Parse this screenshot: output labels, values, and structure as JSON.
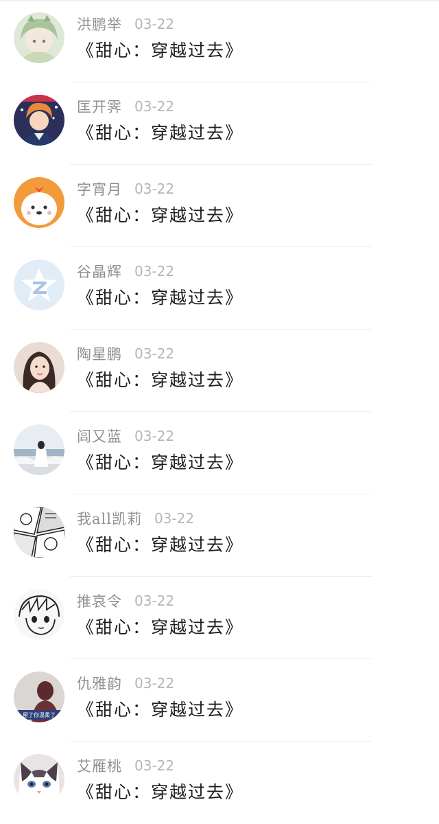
{
  "comments": [
    {
      "name": "洪鹏举",
      "date": "03-22",
      "title": "《甜心：穿越过去》",
      "avatar": "avatar-anime-green-hair-icon"
    },
    {
      "name": "匡开霁",
      "date": "03-22",
      "title": "《甜心：穿越过去》",
      "avatar": "avatar-anime-boy-flag-icon"
    },
    {
      "name": "字宵月",
      "date": "03-22",
      "title": "《甜心：穿越过去》",
      "avatar": "avatar-cartoon-dog-icon"
    },
    {
      "name": "谷晶辉",
      "date": "03-22",
      "title": "《甜心：穿越过去》",
      "avatar": "avatar-qzone-star-icon"
    },
    {
      "name": "陶星鹏",
      "date": "03-22",
      "title": "《甜心：穿越过去》",
      "avatar": "avatar-girl-photo-icon"
    },
    {
      "name": "闾又蓝",
      "date": "03-22",
      "title": "《甜心：穿越过去》",
      "avatar": "avatar-seaside-girl-icon"
    },
    {
      "name": "我all凯莉",
      "date": "03-22",
      "title": "《甜心：穿越过去》",
      "avatar": "avatar-manga-panel-icon"
    },
    {
      "name": "推哀令",
      "date": "03-22",
      "title": "《甜心：穿越过去》",
      "avatar": "avatar-manga-sketch-icon"
    },
    {
      "name": "仇雅韵",
      "date": "03-22",
      "title": "《甜心：穿越过去》",
      "avatar": "avatar-dark-silhouette-icon"
    },
    {
      "name": "艾雁桃",
      "date": "03-22",
      "title": "《甜心：穿越过去》",
      "avatar": "avatar-cat-face-icon"
    }
  ],
  "avatar_captions": {
    "item_8": "留了你温柔了"
  },
  "colors": {
    "name": "#8f8f8f",
    "date": "#b5b5b5",
    "title": "#1e1e1e",
    "divider": "#efefef",
    "background": "#ffffff"
  }
}
